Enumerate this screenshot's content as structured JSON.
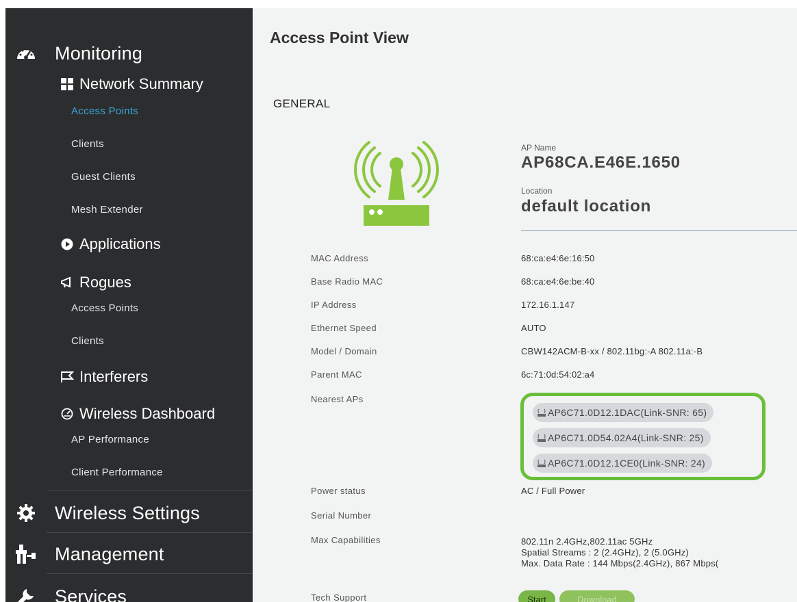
{
  "sidebar": {
    "monitoring": "Monitoring",
    "network_summary": "Network Summary",
    "ns_items": [
      "Access Points",
      "Clients",
      "Guest Clients",
      "Mesh Extender"
    ],
    "applications": "Applications",
    "rogues": "Rogues",
    "rogues_items": [
      "Access Points",
      "Clients"
    ],
    "interferers": "Interferers",
    "wireless_dashboard": "Wireless Dashboard",
    "wd_items": [
      "AP Performance",
      "Client Performance"
    ],
    "wireless_settings": "Wireless Settings",
    "management": "Management",
    "services": "Services"
  },
  "main": {
    "title": "Access Point View",
    "section": "GENERAL",
    "ap_name_label": "AP Name",
    "ap_name": "AP68CA.E46E.1650",
    "location_label": "Location",
    "location": "default location",
    "fields": [
      {
        "label": "MAC Address",
        "value": "68:ca:e4:6e:16:50"
      },
      {
        "label": "Base Radio MAC",
        "value": "68:ca:e4:6e:be:40"
      },
      {
        "label": "IP Address",
        "value": "172.16.1.147"
      },
      {
        "label": "Ethernet Speed",
        "value": "AUTO"
      },
      {
        "label": "Model / Domain",
        "value": "CBW142ACM-B-xx / 802.11bg:-A 802.11a:-B"
      },
      {
        "label": "Parent MAC",
        "value": "6c:71:0d:54:02:a4"
      }
    ],
    "nearest_label": "Nearest APs",
    "nearest_aps": [
      "AP6C71.0D12.1DAC(Link-SNR: 65)",
      "AP6C71.0D54.02A4(Link-SNR: 25)",
      "AP6C71.0D12.1CE0(Link-SNR: 24)"
    ],
    "power_label": "Power status",
    "power_value": "AC / Full Power",
    "serial_label": "Serial Number",
    "serial_value": "",
    "cap_label": "Max Capabilities",
    "cap_lines": [
      "802.11n 2.4GHz,802.11ac 5GHz",
      "Spatial Streams : 2 (2.4GHz), 2 (5.0GHz)",
      "Max. Data Rate : 144 Mbps(2.4GHz), 867 Mbps("
    ],
    "tech_label": "Tech Support",
    "start_label": "Start",
    "download_label": "Download"
  },
  "colors": {
    "sidebar_bg": "#2b2d2f",
    "active_link": "#3ba7d9",
    "highlight_green": "#6abf3a",
    "ap_icon_green": "#8cc63f"
  }
}
